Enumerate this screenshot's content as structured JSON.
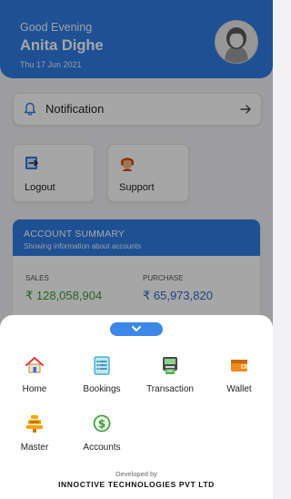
{
  "header": {
    "greeting": "Good Evening",
    "user_name": "Anita Dighe",
    "date": "Thu 17 Jun 2021"
  },
  "notification": {
    "label": "Notification"
  },
  "tiles": {
    "logout_label": "Logout",
    "support_label": "Support"
  },
  "account_summary": {
    "title": "ACCOUNT SUMMARY",
    "subtitle": "Showing information about accounts",
    "sales_label": "SALES",
    "sales_value": "₹ 128,058,904",
    "purchase_label": "PURCHASE",
    "purchase_value": "₹ 65,973,820"
  },
  "menu": {
    "items": [
      {
        "label": "Home",
        "icon": "home-icon"
      },
      {
        "label": "Bookings",
        "icon": "bookings-icon"
      },
      {
        "label": "Transaction",
        "icon": "transaction-icon"
      },
      {
        "label": "Wallet",
        "icon": "wallet-icon"
      },
      {
        "label": "Master",
        "icon": "master-icon"
      },
      {
        "label": "Accounts",
        "icon": "accounts-icon"
      }
    ],
    "developed_by": "Developed by",
    "company": "INNOCTIVE TECHNOLOGIES PVT LTD"
  },
  "colors": {
    "primary": "#2f7be2",
    "sales_value": "#3a9a3a",
    "purchase_value": "#2f66c9"
  }
}
